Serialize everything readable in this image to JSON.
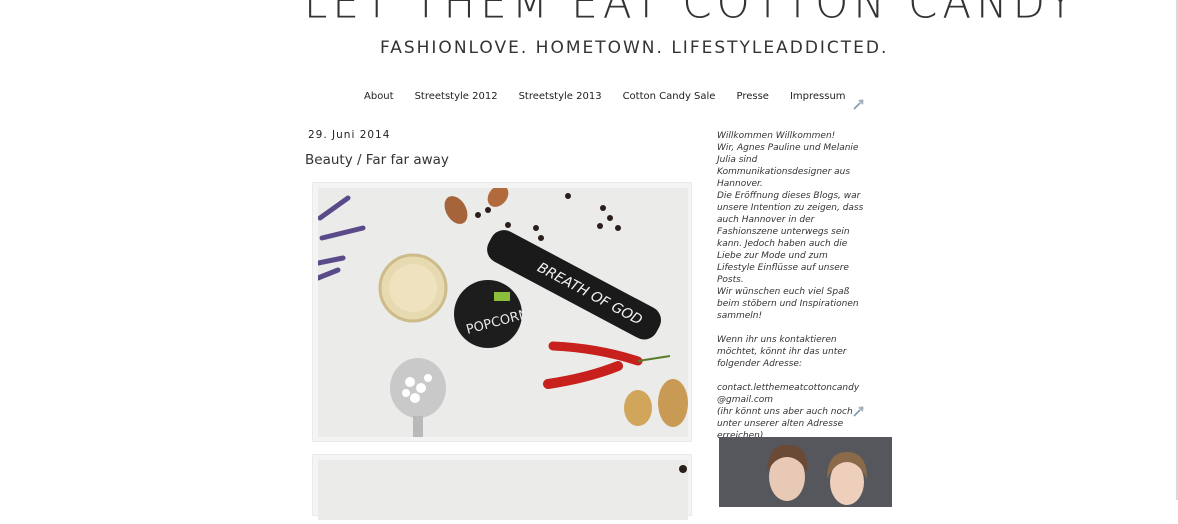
{
  "header": {
    "title": "LET THEM EAT COTTON CANDY",
    "subtitle": "FASHIONLOVE. HOMETOWN. LIFESTYLEADDICTED."
  },
  "nav": {
    "items": [
      "About",
      "Streetstyle 2012",
      "Streetstyle 2013",
      "Cotton Candy Sale",
      "Presse",
      "Impressum"
    ]
  },
  "post": {
    "date": "29. Juni 2014",
    "title": "Beauty / Far far away",
    "product_text_1": "BREATH OF GOD",
    "product_text_2": "POPCORN"
  },
  "sidebar": {
    "lines": [
      "Willkommen Willkommen!",
      "Wir, Agnes Pauline und Melanie Julia sind Kommunikationsdesigner aus Hannover.",
      "Die Eröffnung dieses Blogs, war unsere Intention zu zeigen, dass auch Hannover in der Fashionszene unterwegs sein kann. Jedoch haben auch die Liebe zur Mode und zum Lifestyle Einflüsse auf unsere Posts.",
      "Wir wünschen euch viel Spaß beim stöbern und Inspirationen sammeln!",
      "",
      "Wenn ihr uns kontaktieren möchtet, könnt ihr das unter folgender Adresse:",
      "",
      "contact.letthemeatcottoncandy@gmail.com",
      "(ihr könnt uns aber auch noch unter unserer alten Adresse erreichen)"
    ]
  },
  "icons": {
    "edit": "wrench-screwdriver-icon"
  },
  "colors": {
    "background": "#ffffff",
    "text": "#222222",
    "chili_red": "#c8201c",
    "tube_black": "#1a1a1a",
    "lavender": "#5b4a8a"
  }
}
